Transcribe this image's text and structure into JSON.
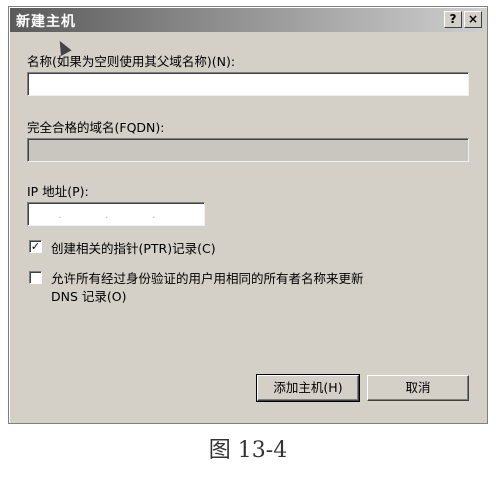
{
  "dialog": {
    "title": "新建主机",
    "help_label": "?",
    "close_label": "×"
  },
  "name_field": {
    "label": "名称(如果为空则使用其父域名称)(N):",
    "value": ""
  },
  "fqdn_field": {
    "label": "完全合格的域名(FQDN):",
    "value": ""
  },
  "ip_field": {
    "label": "IP 地址(P):",
    "value": ". . ."
  },
  "ptr_checkbox": {
    "label": "创建相关的指针(PTR)记录(C)",
    "checked": true,
    "mark": "✓"
  },
  "update_checkbox": {
    "label_line1": "允许所有经过身份验证的用户用相同的所有者名称来更新",
    "label_line2": "DNS 记录(O)",
    "checked": false
  },
  "buttons": {
    "add_host": "添加主机(H)",
    "cancel": "取消"
  },
  "figure_caption": "图 13-4"
}
